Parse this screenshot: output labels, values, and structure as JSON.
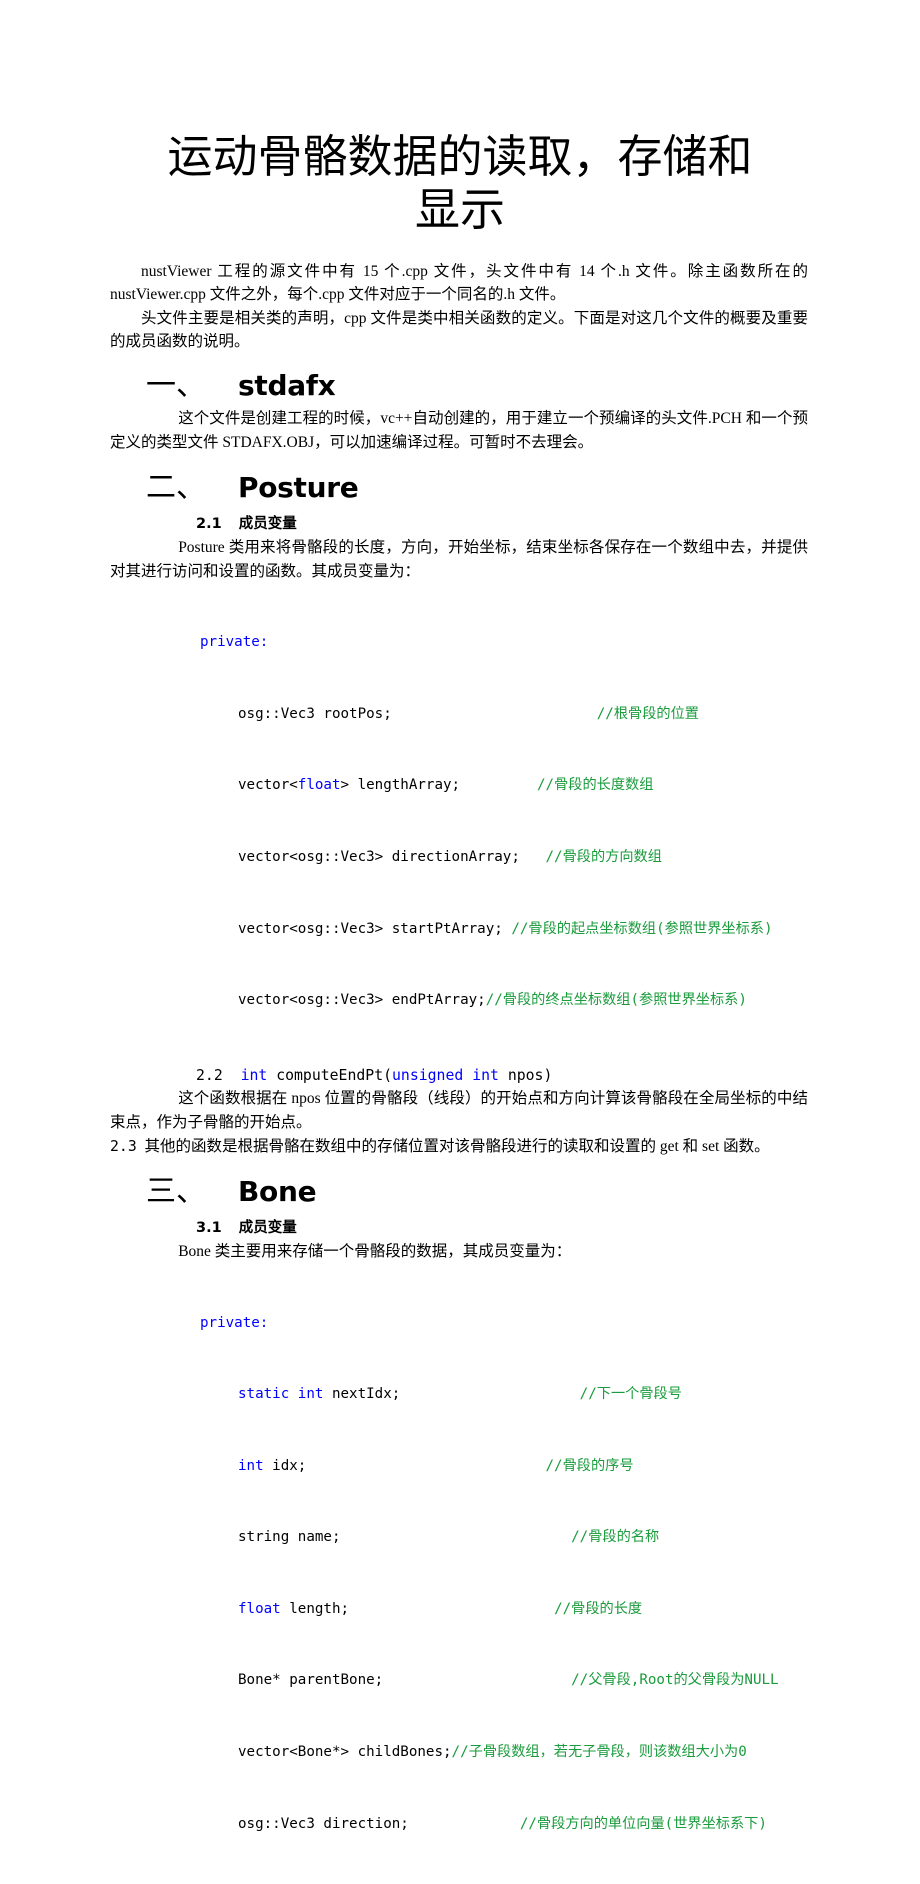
{
  "document": {
    "title": "运动骨骼数据的读取，存储和显示",
    "intro": {
      "p1": "nustViewer 工程的源文件中有 15 个.cpp 文件，头文件中有 14 个.h 文件。除主函数所在的 nustViewer.cpp 文件之外，每个.cpp 文件对应于一个同名的.h 文件。",
      "p2": "头文件主要是相关类的声明，cpp 文件是类中相关函数的定义。下面是对这几个文件的概要及重要的成员函数的说明。"
    },
    "sections": [
      {
        "number": "一、",
        "title": "stdafx",
        "body": "这个文件是创建工程的时候，vc++自动创建的，用于建立一个预编译的头文件.PCH 和一个预定义的类型文件 STDAFX.OBJ，可以加速编译过程。可暂时不去理会。"
      },
      {
        "number": "二、",
        "title": "Posture",
        "sub_number": "2.1",
        "sub_title": "成员变量",
        "body": "Posture 类用来将骨骼段的长度，方向，开始坐标，结束坐标各保存在一个数组中去，并提供对其进行访问和设置的函数。其成员变量为：",
        "access_modifier": "private:",
        "code_lines": [
          {
            "code": "osg::Vec3 rootPos;",
            "pad": "                        ",
            "comment": "//根骨段的位置",
            "kw": ""
          },
          {
            "code_pre": "vector<",
            "kw": "float",
            "code_post": "> lengthArray;",
            "pad": "         ",
            "comment": "//骨段的长度数组"
          },
          {
            "code": "vector<osg::Vec3> directionArray;",
            "pad": "   ",
            "comment": "//骨段的方向数组",
            "kw": ""
          },
          {
            "code": "vector<osg::Vec3> startPtArray;",
            "pad": " ",
            "comment": "//骨段的起点坐标数组(参照世界坐标系)",
            "kw": ""
          },
          {
            "code": "vector<osg::Vec3> endPtArray;",
            "pad": "",
            "comment": "//骨段的终点坐标数组(参照世界坐标系)",
            "kw": ""
          }
        ],
        "item_22": {
          "number": "2.2",
          "signature_parts": [
            {
              "text": "int ",
              "color": "kw"
            },
            {
              "text": "computeEndPt(",
              "color": "plain"
            },
            {
              "text": "unsigned int",
              "color": "kw"
            },
            {
              "text": " npos)",
              "color": "plain"
            }
          ],
          "body": "这个函数根据在 npos 位置的骨骼段（线段）的开始点和方向计算该骨骼段在全局坐标的中结束点，作为子骨骼的开始点。"
        },
        "item_23": {
          "number": "2.3",
          "body": "其他的函数是根据骨骼在数组中的存储位置对该骨骼段进行的读取和设置的 get 和 set 函数。"
        }
      },
      {
        "number": "三、",
        "title": "Bone",
        "sub_number": "3.1",
        "sub_title": "成员变量",
        "body": "Bone 类主要用来存储一个骨骼段的数据，其成员变量为：",
        "access_modifier": "private:",
        "code_lines": [
          {
            "kw": "static int",
            "code_post": " nextIdx;",
            "pad": "                     ",
            "comment": "//下一个骨段号"
          },
          {
            "kw": "int",
            "code_post": " idx;",
            "pad": "                            ",
            "comment": "//骨段的序号"
          },
          {
            "code": "string name;",
            "pad": "                           ",
            "comment": "//骨段的名称",
            "kw": ""
          },
          {
            "kw": "float",
            "code_post": " length;",
            "pad": "                        ",
            "comment": "//骨段的长度"
          },
          {
            "code": "Bone* parentBone;",
            "pad": "                      ",
            "comment": "//父骨段,Root的父骨段为NULL",
            "kw": ""
          },
          {
            "code": "vector<Bone*> childBones;",
            "pad": "",
            "comment": "//子骨段数组，若无子骨段，则该数组大小为0",
            "kw": ""
          },
          {
            "code": "osg::Vec3 direction;",
            "pad": "             ",
            "comment": "//骨段方向的单位向量(世界坐标系下)",
            "kw": ""
          }
        ]
      }
    ],
    "colors": {
      "keyword": "#0000ff",
      "comment": "#1a9b3c",
      "text": "#000000",
      "background": "#ffffff"
    }
  }
}
